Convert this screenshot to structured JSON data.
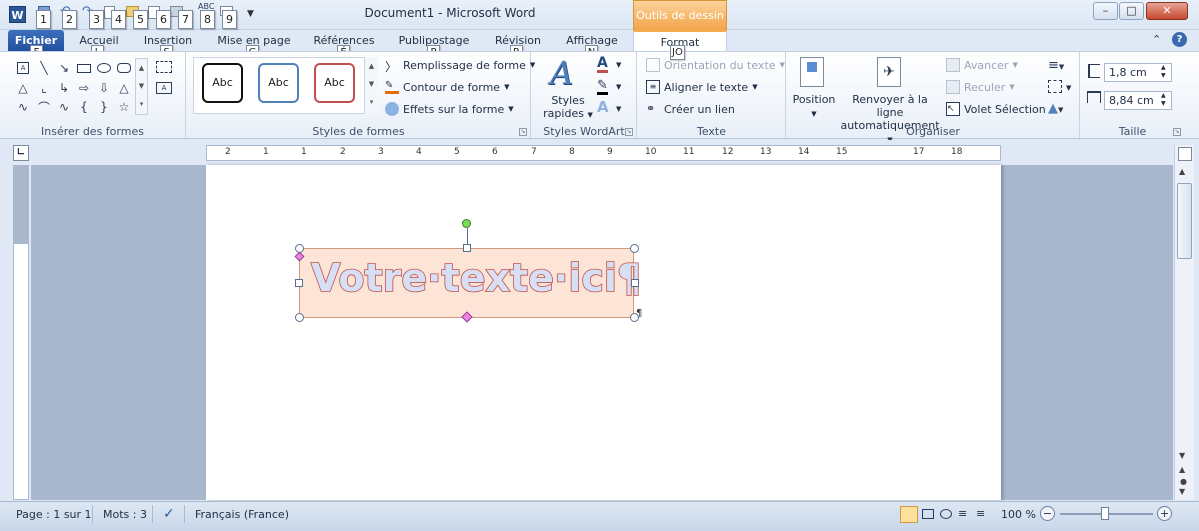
{
  "window": {
    "title": "Document1 - Microsoft Word",
    "contextual_header": "Outils de dessin",
    "app_icon": "W",
    "minimize": "–",
    "maximize": "□",
    "close": "✕"
  },
  "qat_keytips": [
    "1",
    "2",
    "3",
    "4",
    "5",
    "6",
    "7",
    "8",
    "9"
  ],
  "tabs": [
    {
      "label": "Fichier",
      "keytip": "F"
    },
    {
      "label": "Accueil",
      "keytip": "L"
    },
    {
      "label": "Insertion",
      "keytip": "S"
    },
    {
      "label": "Mise en page",
      "keytip": "G"
    },
    {
      "label": "Références",
      "keytip": "É"
    },
    {
      "label": "Publipostage",
      "keytip": "P"
    },
    {
      "label": "Révision",
      "keytip": "R"
    },
    {
      "label": "Affichage",
      "keytip": "N"
    },
    {
      "label": "Format",
      "keytip": "JO"
    }
  ],
  "groups": {
    "insert_shapes": {
      "label": "Insérer des formes"
    },
    "shape_styles": {
      "label": "Styles de formes",
      "samples": [
        "Abc",
        "Abc",
        "Abc"
      ],
      "fill": "Remplissage de forme",
      "outline": "Contour de forme",
      "effects": "Effets sur la forme"
    },
    "wordart": {
      "label": "Styles WordArt",
      "quick_styles": "Styles rapides"
    },
    "text": {
      "label": "Texte",
      "orientation": "Orientation du texte",
      "align": "Aligner le texte",
      "link": "Créer un lien"
    },
    "arrange": {
      "label": "Organiser",
      "position": "Position",
      "wrap": "Renvoyer à la ligne automatiquement",
      "wrap_line1": "Renvoyer à la ligne",
      "wrap_line2": "automatiquement",
      "forward": "Avancer",
      "backward": "Reculer",
      "selection_pane": "Volet Sélection"
    },
    "size": {
      "label": "Taille",
      "height": "1,8 cm",
      "width": "8,84 cm"
    }
  },
  "ruler_numbers": [
    "2",
    "1",
    "1",
    "2",
    "3",
    "4",
    "5",
    "6",
    "7",
    "8",
    "9",
    "10",
    "11",
    "12",
    "13",
    "14",
    "15",
    "17",
    "18"
  ],
  "document": {
    "wordart_text": "Votre·texte·ici¶"
  },
  "status": {
    "page": "Page : 1 sur 1",
    "words": "Mots : 3",
    "language": "Français (France)",
    "zoom": "100 %"
  },
  "colors": {
    "accent": "#2b5797",
    "contextual": "#f2a448",
    "wordart_fill": "#d7dff5",
    "wordart_outline": "#c0504d"
  }
}
